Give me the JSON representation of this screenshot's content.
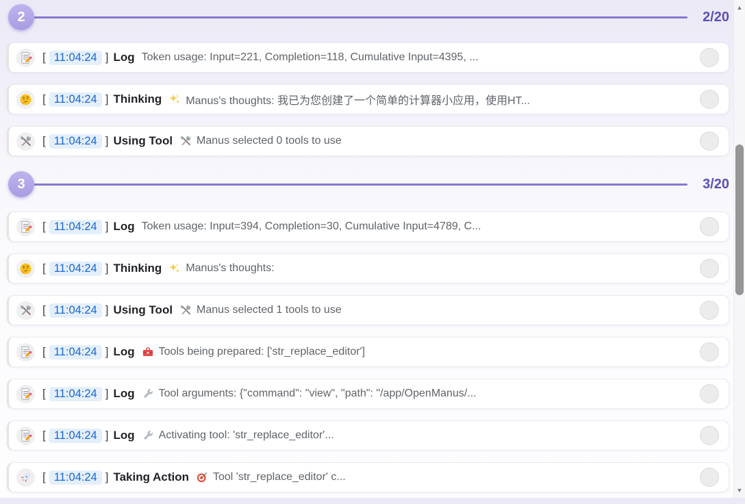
{
  "chrome": {
    "bracket_open": "[",
    "bracket_close": "]"
  },
  "scrollbar": {
    "up": "▲",
    "down": "▼"
  },
  "colors": {
    "accent_purple": "#8478d0",
    "progress_text": "#5a50b7",
    "time_text": "#1967d2",
    "time_bg": "#e4effc",
    "card_bg": "#ffffff",
    "page_bg_top": "#ece9f7"
  },
  "sections": [
    {
      "number": "2",
      "progress": "2/20",
      "cards": [
        {
          "icon": "memo-icon",
          "time": "11:04:24",
          "label": "Log",
          "message": "Token usage: Input=221, Completion=118, Cumulative Input=4395, ..."
        },
        {
          "icon": "thinking-face-icon",
          "time": "11:04:24",
          "label": "Thinking",
          "message_icon": "sparkles-icon",
          "message": "Manus's thoughts: 我已为您创建了一个简单的计算器小应用，使用HT..."
        },
        {
          "icon": "hammer-wrench-icon",
          "time": "11:04:24",
          "label": "Using Tool",
          "message_icon": "hammer-wrench-icon",
          "message": "Manus selected 0 tools to use"
        }
      ]
    },
    {
      "number": "3",
      "progress": "3/20",
      "cards": [
        {
          "icon": "memo-icon",
          "time": "11:04:24",
          "label": "Log",
          "message": "Token usage: Input=394, Completion=30, Cumulative Input=4789, C..."
        },
        {
          "icon": "thinking-face-icon",
          "time": "11:04:24",
          "label": "Thinking",
          "message_icon": "sparkles-icon",
          "message": "Manus's thoughts:"
        },
        {
          "icon": "hammer-wrench-icon",
          "time": "11:04:24",
          "label": "Using Tool",
          "message_icon": "hammer-wrench-icon",
          "message": "Manus selected 1 tools to use"
        },
        {
          "icon": "memo-icon",
          "time": "11:04:24",
          "label": "Log",
          "message_icon": "toolbox-icon",
          "message": "Tools being prepared: ['str_replace_editor']"
        },
        {
          "icon": "memo-icon",
          "time": "11:04:24",
          "label": "Log",
          "message_icon": "wrench-icon",
          "message": "Tool arguments: {\"command\": \"view\", \"path\": \"/app/OpenManus/..."
        },
        {
          "icon": "memo-icon",
          "time": "11:04:24",
          "label": "Log",
          "message_icon": "wrench-icon",
          "message": "Activating tool: 'str_replace_editor'..."
        },
        {
          "icon": "rocket-icon",
          "time": "11:04:24",
          "label": "Taking Action",
          "message_icon": "dart-icon",
          "message": "Tool 'str_replace_editor' c..."
        }
      ]
    }
  ]
}
